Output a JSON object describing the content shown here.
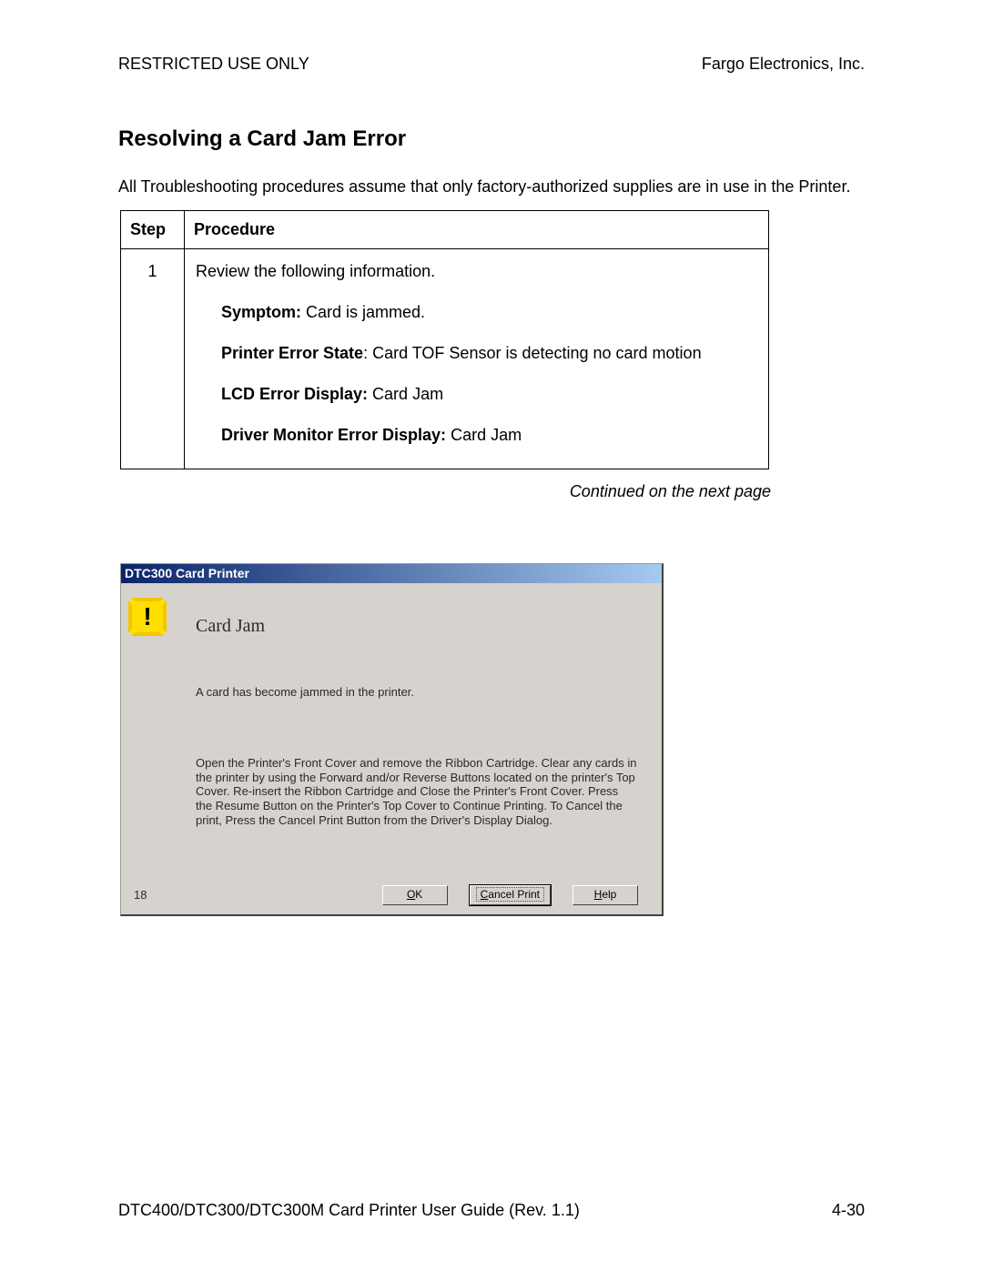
{
  "header": {
    "left": "RESTRICTED USE ONLY",
    "right": "Fargo Electronics, Inc."
  },
  "section_title": "Resolving a Card Jam Error",
  "intro": "All Troubleshooting procedures assume that only factory-authorized supplies are in use in the Printer.",
  "table": {
    "headers": {
      "step": "Step",
      "procedure": "Procedure"
    },
    "row": {
      "num": "1",
      "line_first": "Review the following information.",
      "symptom_label": "Symptom:",
      "symptom_value": "  Card is jammed.",
      "state_label": "Printer Error State",
      "state_value": ":  Card TOF Sensor is detecting no card motion",
      "lcd_label": "LCD Error Display:",
      "lcd_value": "  Card Jam",
      "driver_label": "Driver Monitor Error Display:",
      "driver_value": "  Card Jam"
    }
  },
  "continued": "Continued on the next page",
  "dialog": {
    "title": "DTC300 Card Printer",
    "heading": "Card Jam",
    "text1": "A card has become jammed in the printer.",
    "text2": "Open the Printer's Front Cover and remove the Ribbon Cartridge. Clear any cards in the printer by using the Forward and/or Reverse Buttons located on the printer's Top Cover. Re-insert the Ribbon Cartridge and Close the Printer's Front Cover. Press the Resume Button on the Printer's Top Cover to Continue Printing. To Cancel the print, Press the Cancel Print Button from the Driver's Display Dialog.",
    "count": "18",
    "buttons": {
      "ok_u": "O",
      "ok_rest": "K",
      "cancel_u": "C",
      "cancel_rest": "ancel Print",
      "help_u": "H",
      "help_rest": "elp"
    }
  },
  "footer": {
    "left": "DTC400/DTC300/DTC300M Card Printer User Guide (Rev. 1.1)",
    "right": "4-30"
  }
}
